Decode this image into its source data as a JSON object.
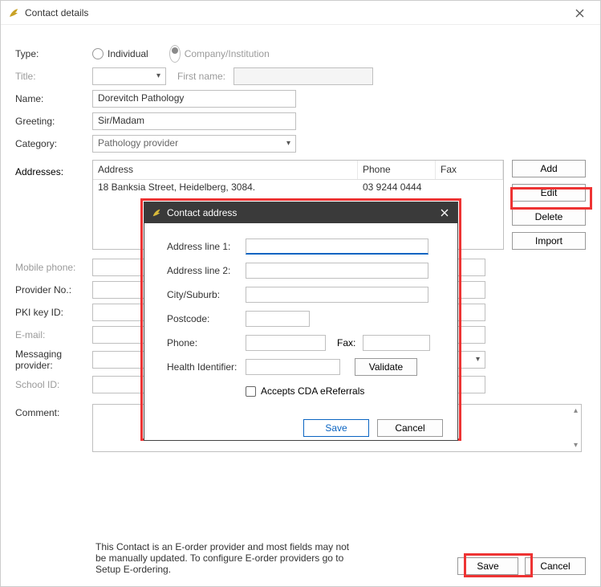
{
  "window": {
    "title": "Contact details"
  },
  "fields": {
    "type_label": "Type:",
    "type_individual": "Individual",
    "type_company": "Company/Institution",
    "title_label": "Title:",
    "firstname_label": "First name:",
    "name_label": "Name:",
    "name_value": "Dorevitch Pathology",
    "greeting_label": "Greeting:",
    "greeting_value": "Sir/Madam",
    "category_label": "Category:",
    "category_value": "Pathology provider",
    "addresses_label": "Addresses:",
    "mobile_label": "Mobile phone:",
    "provider_label": "Provider No.:",
    "pki_label": "PKI key ID:",
    "email_label": "E-mail:",
    "messaging_label1": "Messaging",
    "messaging_label2": "provider:",
    "school_label": "School ID:",
    "comment_label": "Comment:"
  },
  "grid": {
    "h_address": "Address",
    "h_phone": "Phone",
    "h_fax": "Fax",
    "row0_address": "18 Banksia Street, Heidelberg, 3084.",
    "row0_phone": "03 9244 0444",
    "row0_fax": ""
  },
  "sidebtns": {
    "add": "Add",
    "edit": "Edit",
    "delete": "Delete",
    "import": "Import"
  },
  "footer": {
    "note": "This Contact is an E-order provider and most fields may not be manually updated. To configure E-order providers go to Setup E-ordering.",
    "save": "Save",
    "cancel": "Cancel"
  },
  "modal": {
    "title": "Contact address",
    "addr1": "Address line 1:",
    "addr2": "Address line 2:",
    "city": "City/Suburb:",
    "postcode": "Postcode:",
    "phone": "Phone:",
    "fax": "Fax:",
    "health_id": "Health Identifier:",
    "validate": "Validate",
    "accepts": "Accepts CDA eReferrals",
    "save": "Save",
    "cancel": "Cancel"
  }
}
